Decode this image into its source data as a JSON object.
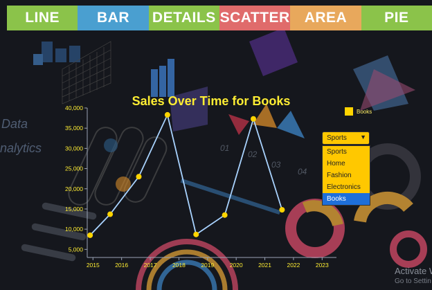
{
  "nav": {
    "tabs": [
      {
        "label": "LINE",
        "color": "#8bc34a"
      },
      {
        "label": "BAR",
        "color": "#4a9fd0"
      },
      {
        "label": "DETAILS",
        "color": "#8bc34a"
      },
      {
        "label": "SCATTER",
        "color": "#e06b6b"
      },
      {
        "label": "AREA",
        "color": "#e8a85c"
      },
      {
        "label": "PIE",
        "color": "#8bc34a"
      }
    ]
  },
  "selector": {
    "selected": "Sports",
    "options": [
      "Sports",
      "Home",
      "Fashion",
      "Electronics",
      "Books"
    ],
    "highlighted": "Books"
  },
  "watermark": {
    "title": "Activate Wi",
    "subtitle": "Go to Settin"
  },
  "colors": {
    "line": "#a9d3ff",
    "point": "#ffd400",
    "tick": "#ffee33",
    "title": "#ffee33",
    "dropdown": "#ffc800",
    "dropdown_highlight": "#1e6fd9"
  },
  "chart_data": {
    "type": "line",
    "title": "Sales Over Time for Books",
    "xlabel": "",
    "ylabel": "",
    "x_ticks": [
      "2015",
      "2016",
      "2017",
      "2018",
      "2019",
      "2020",
      "2021",
      "2022",
      "2023"
    ],
    "y_ticks": [
      "5,000",
      "10,000",
      "15,000",
      "20,000",
      "25,000",
      "30,000",
      "35,000",
      "40,000"
    ],
    "xlim": [
      2014.8,
      2023.5
    ],
    "ylim": [
      3000,
      40000
    ],
    "series": [
      {
        "name": "Books",
        "x": [
          2014.9,
          2015.6,
          2016.6,
          2017.6,
          2018.6,
          2019.6,
          2020.6,
          2021.6
        ],
        "values": [
          8500,
          13700,
          23000,
          38300,
          8700,
          13500,
          37300,
          14800
        ]
      }
    ],
    "legend": "top-right",
    "grid": false
  }
}
